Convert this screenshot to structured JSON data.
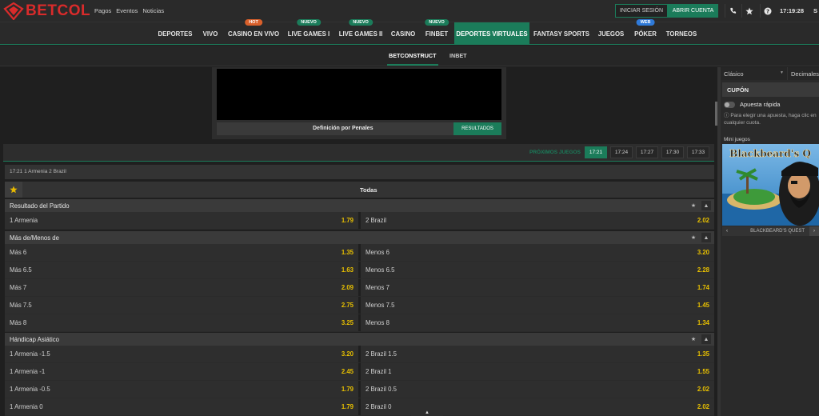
{
  "header": {
    "logo_text": "BETCOL",
    "links": [
      "Pagos",
      "Eventos",
      "Noticias"
    ],
    "login_label": "INICIAR SESIÓN",
    "register_label": "ABRIR CUENTA",
    "time": "17:19:28",
    "user_initial": "S"
  },
  "nav": {
    "items": [
      {
        "label": "DEPORTES",
        "badge": ""
      },
      {
        "label": "VIVO",
        "badge": ""
      },
      {
        "label": "CASINO EN VIVO",
        "badge": "HOT"
      },
      {
        "label": "LIVE GAMES I",
        "badge": "NUEVO"
      },
      {
        "label": "LIVE GAMES II",
        "badge": "NUEVO"
      },
      {
        "label": "CASINO",
        "badge": ""
      },
      {
        "label": "FINBET",
        "badge": "NUEVO"
      },
      {
        "label": "DEPORTES VIRTUALES",
        "badge": ""
      },
      {
        "label": "FANTASY SPORTS",
        "badge": ""
      },
      {
        "label": "JUEGOS",
        "badge": ""
      },
      {
        "label": "PÓKER",
        "badge": "WEB"
      },
      {
        "label": "TORNEOS",
        "badge": ""
      }
    ],
    "active": "DEPORTES VIRTUALES"
  },
  "subnav": {
    "items": [
      "BETCONSTRUCT",
      "INBET"
    ]
  },
  "video": {
    "label": "Definición por Penales",
    "results_label": "RESULTADOS"
  },
  "times": {
    "next_label": "PRÓXIMOS JUEGOS",
    "slots": [
      "17:21",
      "17:24",
      "17:27",
      "17:30",
      "17:33"
    ]
  },
  "match": {
    "info": "17:21 1 Armenia 2 Brazil",
    "all_label": "Todas"
  },
  "markets": [
    {
      "title": "Resultado del Partido",
      "rows": [
        [
          {
            "name": "1 Armenia",
            "odd": "1.79"
          },
          {
            "name": "2 Brazil",
            "odd": "2.02"
          }
        ]
      ]
    },
    {
      "title": "Más de/Menos de",
      "rows": [
        [
          {
            "name": "Más 6",
            "odd": "1.35"
          },
          {
            "name": "Menos 6",
            "odd": "3.20"
          }
        ],
        [
          {
            "name": "Más 6.5",
            "odd": "1.63"
          },
          {
            "name": "Menos 6.5",
            "odd": "2.28"
          }
        ],
        [
          {
            "name": "Más 7",
            "odd": "2.09"
          },
          {
            "name": "Menos 7",
            "odd": "1.74"
          }
        ],
        [
          {
            "name": "Más 7.5",
            "odd": "2.75"
          },
          {
            "name": "Menos 7.5",
            "odd": "1.45"
          }
        ],
        [
          {
            "name": "Más 8",
            "odd": "3.25"
          },
          {
            "name": "Menos 8",
            "odd": "1.34"
          }
        ]
      ]
    },
    {
      "title": "Hándicap Asiático",
      "rows": [
        [
          {
            "name": "1 Armenia -1.5",
            "odd": "3.20"
          },
          {
            "name": "2 Brazil 1.5",
            "odd": "1.35"
          }
        ],
        [
          {
            "name": "1 Armenia -1",
            "odd": "2.45"
          },
          {
            "name": "2 Brazil 1",
            "odd": "1.55"
          }
        ],
        [
          {
            "name": "1 Armenia -0.5",
            "odd": "1.79"
          },
          {
            "name": "2 Brazil 0.5",
            "odd": "2.02"
          }
        ],
        [
          {
            "name": "1 Armenia 0",
            "odd": "1.79"
          },
          {
            "name": "2 Brazil 0",
            "odd": "2.02"
          }
        ]
      ]
    }
  ],
  "sidebar": {
    "view_select": "Clásico",
    "odds_select": "Decimales",
    "coupon_title": "CUPÓN",
    "quick_bet_label": "Apuesta rápida",
    "hint": "Para elegir una apuesta, haga clic en cualquier cuota.",
    "mini_games_label": "Mini juegos",
    "mini_game_name": "BLACKBEARD'S QUEST",
    "mini_game_art_text": "Blackbeard's Q"
  },
  "colors": {
    "accent": "#1b7c5a",
    "odds": "#e8c000",
    "brand_red": "#d92b2b"
  }
}
